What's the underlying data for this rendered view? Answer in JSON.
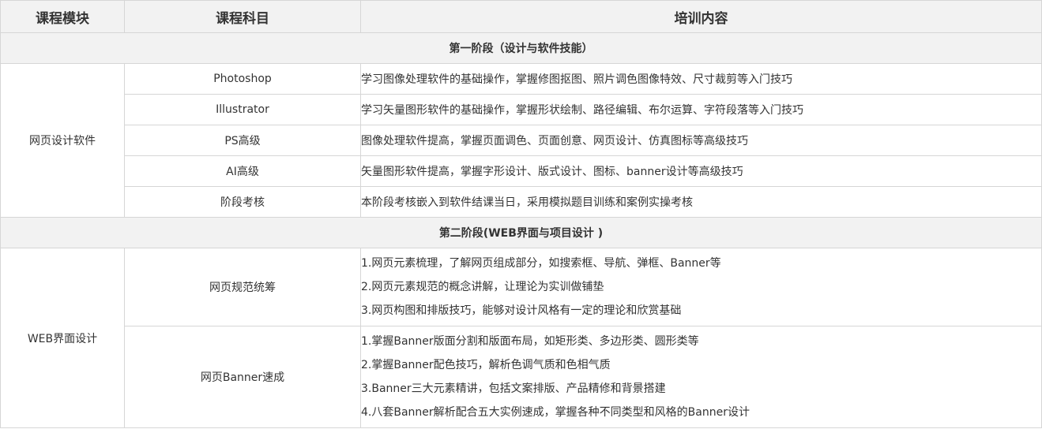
{
  "header": {
    "module": "课程模块",
    "subject": "课程科目",
    "content": "培训内容"
  },
  "stage1": {
    "title": "第一阶段（设计与软件技能）",
    "module": "网页设计软件",
    "rows": [
      {
        "subject": "Photoshop",
        "content": "学习图像处理软件的基础操作，掌握修图抠图、照片调色图像特效、尺寸裁剪等入门技巧"
      },
      {
        "subject": "Illustrator",
        "content": "学习矢量图形软件的基础操作，掌握形状绘制、路径编辑、布尔运算、字符段落等入门技巧"
      },
      {
        "subject": "PS高级",
        "content": "图像处理软件提高，掌握页面调色、页面创意、网页设计、仿真图标等高级技巧"
      },
      {
        "subject": "AI高级",
        "content": "矢量图形软件提高，掌握字形设计、版式设计、图标、banner设计等高级技巧"
      },
      {
        "subject": "阶段考核",
        "content": "本阶段考核嵌入到软件结课当日，采用模拟题目训练和案例实操考核"
      }
    ]
  },
  "stage2": {
    "title": "第二阶段(WEB界面与项目设计 )",
    "module": "WEB界面设计",
    "rows": [
      {
        "subject": "网页规范统筹",
        "lines": [
          "1.网页元素梳理，了解网页组成部分，如搜索框、导航、弹框、Banner等",
          "2.网页元素规范的概念讲解，让理论为实训做铺垫",
          "3.网页构图和排版技巧，能够对设计风格有一定的理论和欣赏基础"
        ]
      },
      {
        "subject": "网页Banner速成",
        "lines": [
          "1.掌握Banner版面分割和版面布局，如矩形类、多边形类、圆形类等",
          "2.掌握Banner配色技巧，解析色调气质和色相气质",
          "3.Banner三大元素精讲，包括文案排版、产品精修和背景搭建",
          "4.八套Banner解析配合五大实例速成，掌握各种不同类型和风格的Banner设计"
        ]
      }
    ]
  }
}
